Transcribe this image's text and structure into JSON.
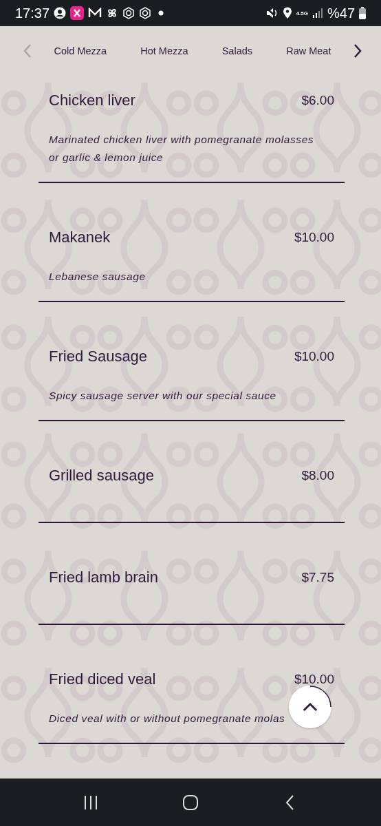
{
  "status_bar": {
    "time": "17:37",
    "network": "4.5G",
    "battery": "%47"
  },
  "category_nav": {
    "prev_disabled": true,
    "next_disabled": false,
    "tabs": [
      {
        "label": "Cold Mezza"
      },
      {
        "label": "Hot Mezza"
      },
      {
        "label": "Salads"
      },
      {
        "label": "Raw Meat"
      }
    ]
  },
  "menu_items": [
    {
      "name": "Chicken liver",
      "price": "$6.00",
      "description": "Marinated chicken liver with pomegranate molasses or garlic & lemon juice"
    },
    {
      "name": "Makanek",
      "price": "$10.00",
      "description": "Lebanese sausage"
    },
    {
      "name": "Fried Sausage",
      "price": "$10.00",
      "description": "Spicy sausage server with our special sauce"
    },
    {
      "name": "Grilled sausage",
      "price": "$8.00"
    },
    {
      "name": "Fried lamb brain",
      "price": "$7.75"
    },
    {
      "name": "Fried diced veal",
      "price": "$10.00",
      "description": "Diced veal with or without pomegranate molas"
    }
  ]
}
